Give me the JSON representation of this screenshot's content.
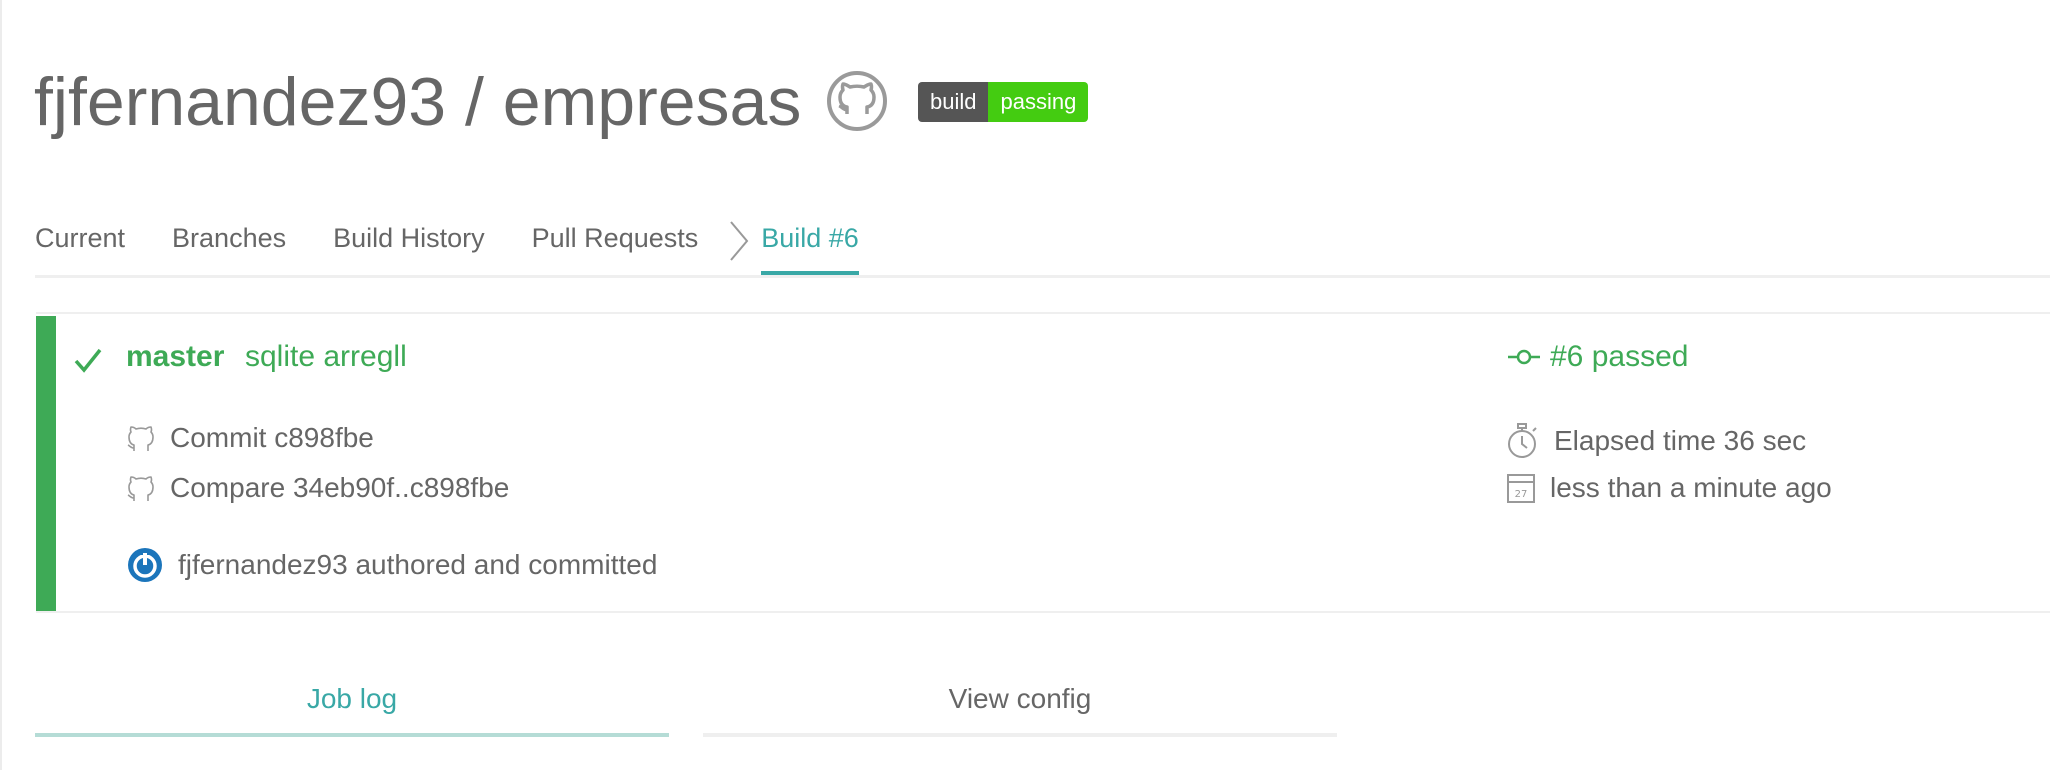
{
  "header": {
    "owner": "fjfernandez93",
    "separator": " / ",
    "repo": "empresas",
    "badge_left": "build",
    "badge_right": "passing"
  },
  "tabs": [
    {
      "label": "Current"
    },
    {
      "label": "Branches"
    },
    {
      "label": "Build History"
    },
    {
      "label": "Pull Requests"
    },
    {
      "label": "Build #6",
      "active": true
    }
  ],
  "build": {
    "branch": "master",
    "message": "sqlite arregll",
    "commit": "Commit c898fbe",
    "compare": "Compare 34eb90f..c898fbe",
    "author_line": "fjfernandez93 authored and committed",
    "status": "#6 passed",
    "elapsed": "Elapsed time 36 sec",
    "finished": "less than a minute ago",
    "calendar_day": "27",
    "status_color": "#3eaa56"
  },
  "bottom_tabs": {
    "job_log": "Job log",
    "view_config": "View config"
  },
  "colors": {
    "accent": "#39a8a6",
    "passed": "#3eaa56",
    "badge_green": "#44cc11",
    "badge_gray": "#555555"
  }
}
